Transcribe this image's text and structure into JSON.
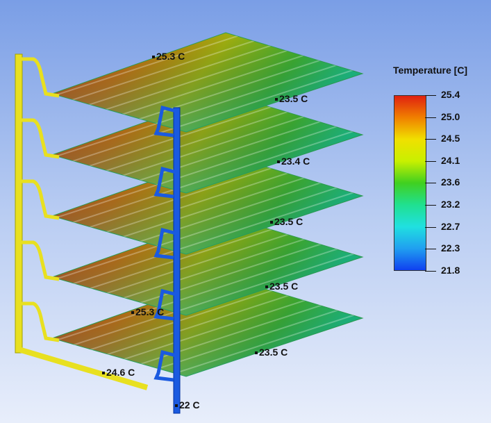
{
  "legend": {
    "title": "Temperature [C]",
    "values": [
      "25.4",
      "25.0",
      "24.5",
      "24.1",
      "23.6",
      "23.2",
      "22.7",
      "22.3",
      "21.8"
    ],
    "colors": [
      "#e02010",
      "#f08000",
      "#f0e000",
      "#c8f000",
      "#40d020",
      "#20e090",
      "#20e0e0",
      "#20a0f0",
      "#1040f0"
    ]
  },
  "probes": [
    "25.3 C",
    "23.5 C",
    "23.4 C",
    "23.5 C",
    "23.5 C",
    "25.3 C",
    "23.5 C",
    "24.6 C",
    "22 C"
  ],
  "colors": {
    "inlet_pipe": "#e8e020",
    "outlet_pipe": "#1a5ae0",
    "hot": "#d04010",
    "cool": "#20c060"
  }
}
